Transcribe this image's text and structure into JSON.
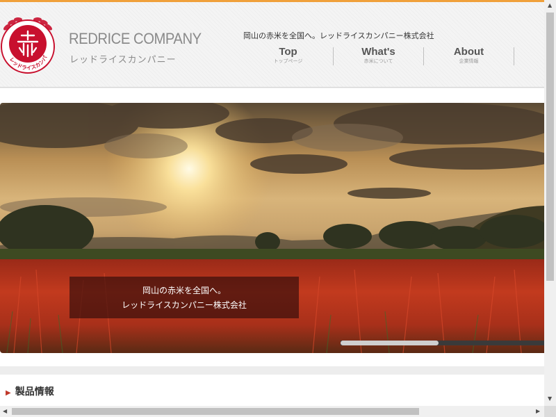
{
  "brand": {
    "name_en": "REDRICE COMPANY",
    "name_ja": "レッドライスカンパニー",
    "logo_text": "レッドライスカンパニー"
  },
  "header": {
    "tagline": "岡山の赤米を全国へ。レッドライスカンパニー株式会社"
  },
  "nav": [
    {
      "en": "Top",
      "ja": "トップページ"
    },
    {
      "en": "What's",
      "ja": "赤米について"
    },
    {
      "en": "About",
      "ja": "企業情報"
    }
  ],
  "slider": {
    "caption_line1": "岡山の赤米を全国へ。",
    "caption_line2": "レッドライスカンパニー株式会社",
    "progress": 0.48
  },
  "section": {
    "title": "製品情報"
  },
  "colors": {
    "accent": "#f0a03a",
    "brand_red": "#c8102e"
  }
}
